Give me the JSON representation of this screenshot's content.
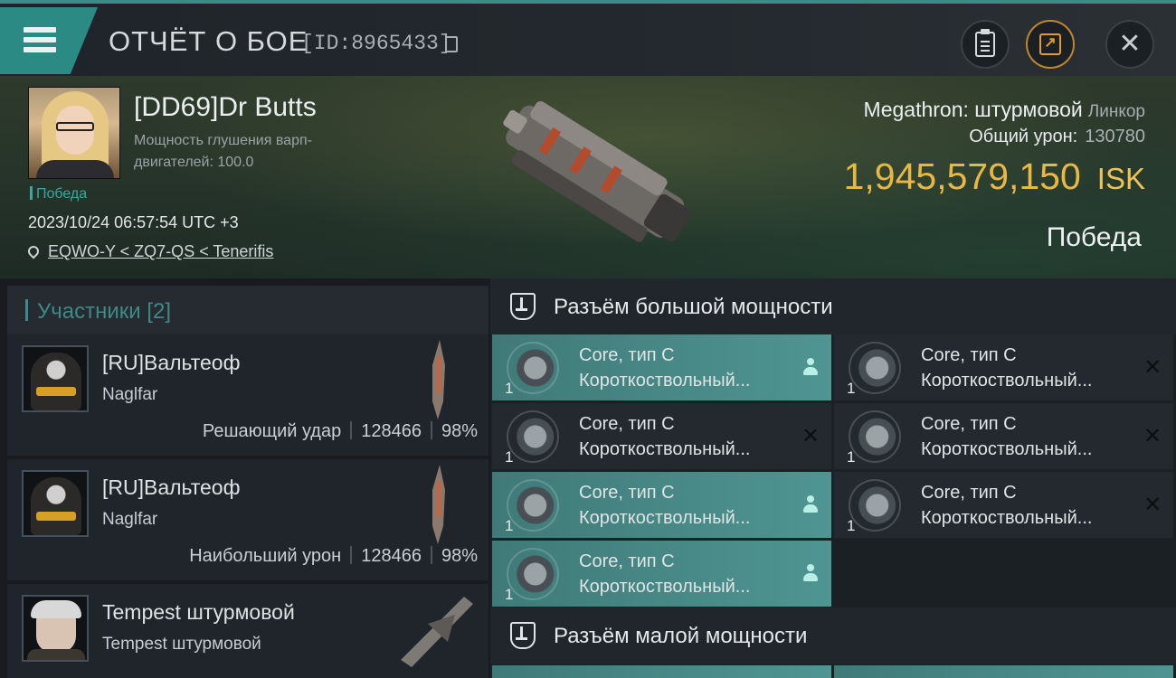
{
  "header": {
    "title": "ОТЧЁТ О БОЕ",
    "report_id": "[ID:8965433]",
    "icons": [
      "menu-icon",
      "copy-icon",
      "clipboard-icon",
      "share-icon",
      "close-icon"
    ]
  },
  "victim": {
    "name": "[DD69]Dr Butts",
    "jam_label": "Мощность глушения варп-двигателей: 100.0",
    "result_tag": "Победа",
    "datetime": "2023/10/24 06:57:54 UTC +3",
    "location": "EQWO-Y < ZQ7-QS < Tenerifis",
    "ship": "Megathron: штурмовой",
    "ship_class": "Линкор",
    "total_damage_label": "Общий урон:",
    "total_damage": "130780",
    "isk_value": "1,945,579,150",
    "isk_unit": "ISK",
    "outcome": "Победа"
  },
  "participants": {
    "header": "Участники [2]",
    "rows": [
      {
        "name": "[RU]Вальтеоф",
        "ship": "Naglfar",
        "role": "Решающий удар",
        "damage": "128466",
        "percent": "98%"
      },
      {
        "name": "[RU]Вальтеоф",
        "ship": "Naglfar",
        "role": "Наибольший урон",
        "damage": "128466",
        "percent": "98%"
      },
      {
        "name": "Tempest штурмовой",
        "ship": "Tempest штурмовой",
        "role": "",
        "damage": "",
        "percent": ""
      }
    ]
  },
  "slots": {
    "high_header": "Разъём большой мощности",
    "low_header": "Разъём малой мощности",
    "high": [
      {
        "count": "1",
        "line1": "Core, тип C",
        "line2": "Коротк­оствольный...",
        "status": "person"
      },
      {
        "count": "1",
        "line1": "Core, тип C",
        "line2": "Коротк­оствольный...",
        "status": "destroyed"
      },
      {
        "count": "1",
        "line1": "Core, тип C",
        "line2": "Коротк­оствольный...",
        "status": "destroyed"
      },
      {
        "count": "1",
        "line1": "Core, тип C",
        "line2": "Коротк­оствольный...",
        "status": "destroyed"
      },
      {
        "count": "1",
        "line1": "Core, тип C",
        "line2": "Коротк­оствольный...",
        "status": "person"
      },
      {
        "count": "1",
        "line1": "Core, тип C",
        "line2": "Коротк­оствольный...",
        "status": "destroyed"
      },
      {
        "count": "1",
        "line1": "Core, тип C",
        "line2": "Коротк­оствольный...",
        "status": "person"
      }
    ]
  },
  "colors": {
    "accent": "#3d8b86",
    "isk": "#e8b744",
    "share_ring": "#c0862c"
  }
}
